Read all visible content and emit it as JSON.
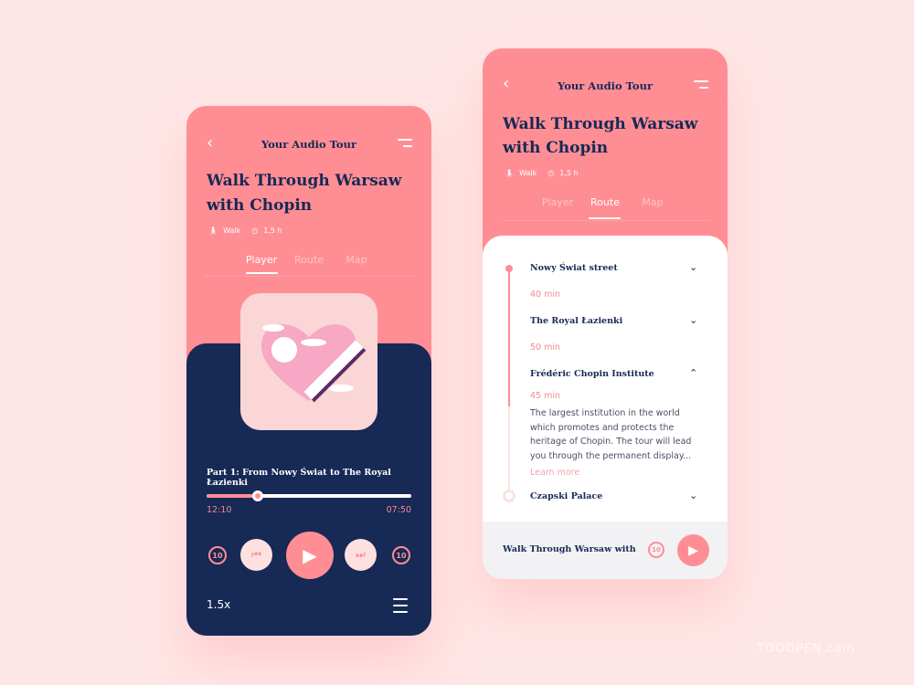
{
  "colors": {
    "accent": "#ff8e94",
    "navy": "#172955",
    "background": "#ffe6e6"
  },
  "player_screen": {
    "header": {
      "title": "Your Audio Tour",
      "back_icon": "chevron-left-icon",
      "menu_icon": "menu-icon"
    },
    "tour_title": [
      "Walk Through Warsaw",
      "with Chopin"
    ],
    "meta": {
      "mode": "Walk",
      "duration": "1,5 h"
    },
    "tabs": [
      {
        "label": "Player",
        "active": true
      },
      {
        "label": "Route",
        "active": false
      },
      {
        "label": "Map",
        "active": false
      }
    ],
    "track_title": "Part 1: From Nowy Świat to The Royal Łazienki",
    "progress": 0.25,
    "time_elapsed": "12:10",
    "time_remaining": "07:50",
    "controls": {
      "rewind": "10",
      "forward": "10"
    },
    "speed": "1.5x"
  },
  "route_screen": {
    "header": {
      "title": "Your Audio Tour"
    },
    "tour_title": [
      "Walk Through Warsaw",
      "with Chopin"
    ],
    "meta": {
      "mode": "Walk",
      "duration": "1,5 h"
    },
    "tabs": [
      {
        "label": "Player",
        "active": false
      },
      {
        "label": "Route",
        "active": true
      },
      {
        "label": "Map",
        "active": false
      }
    ],
    "stops": [
      {
        "name": "Nowy Świat street",
        "duration": "40 min",
        "expanded": false
      },
      {
        "name": "The Royal Łazienki",
        "duration": "50 min",
        "expanded": false
      },
      {
        "name": "Frédéric Chopin Institute",
        "duration": "45 min",
        "expanded": true,
        "description": "The largest institution in the world which promotes and protects the heritage of Chopin. The tour will lead you through the permanent display...",
        "link": "Learn more"
      },
      {
        "name": "Czapski Palace",
        "expanded": false
      }
    ],
    "mini_player": {
      "title": "Walk Through Warsaw with Chopin",
      "rewind": "10"
    }
  },
  "watermark": "TOOOPEN.com"
}
